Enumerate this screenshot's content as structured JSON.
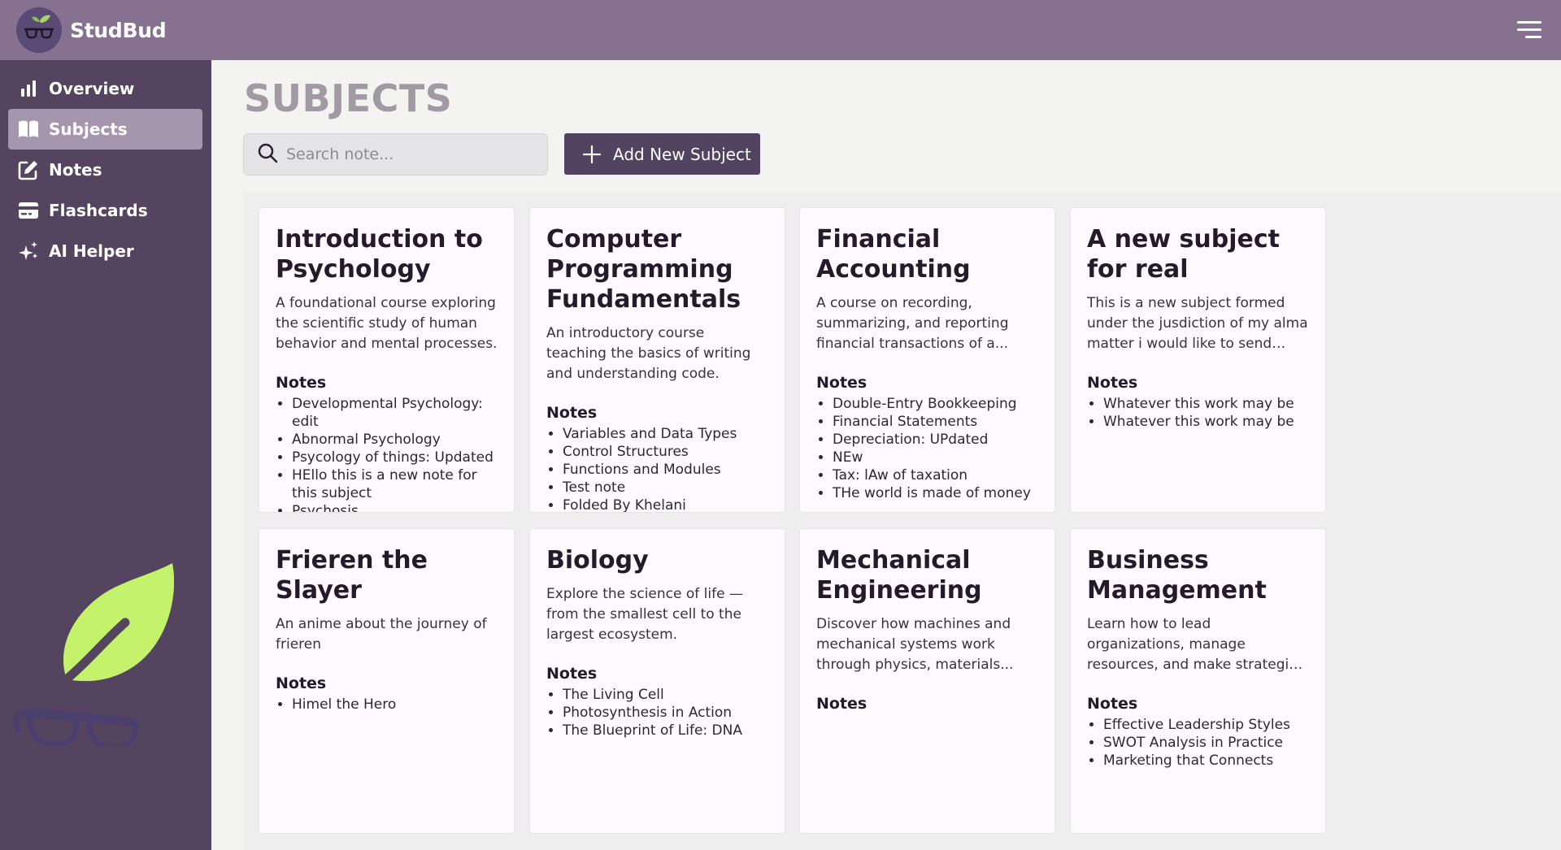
{
  "app": {
    "name": "StudBud"
  },
  "sidebar": {
    "items": [
      {
        "label": "Overview",
        "icon": "bar-chart-icon",
        "active": false
      },
      {
        "label": "Subjects",
        "icon": "book-icon",
        "active": true
      },
      {
        "label": "Notes",
        "icon": "edit-icon",
        "active": false
      },
      {
        "label": "Flashcards",
        "icon": "card-icon",
        "active": false
      },
      {
        "label": "AI Helper",
        "icon": "sparkle-icon",
        "active": false
      }
    ]
  },
  "page": {
    "title": "SUBJECTS",
    "search_placeholder": "Search note...",
    "add_button_label": "Add New Subject"
  },
  "subjects": [
    {
      "title": "Introduction to Psychology",
      "description": "A foundational course exploring the scientific study of human behavior and mental processes.",
      "notes_label": "Notes",
      "notes": [
        "Developmental Psychology: edit",
        "Abnormal Psychology",
        "Psycology of things: Updated",
        "HEllo this is a new note for this subject",
        "Psychosis"
      ]
    },
    {
      "title": "Computer Programming Fundamentals",
      "description": "An introductory course teaching the basics of writing and understanding code.",
      "notes_label": "Notes",
      "notes": [
        "Variables and Data Types",
        "Control Structures",
        "Functions and Modules",
        "Test note",
        "Folded By Khelani"
      ]
    },
    {
      "title": "Financial Accounting",
      "description": "A course on recording, summarizing, and reporting financial transactions of a...",
      "notes_label": "Notes",
      "notes": [
        "Double-Entry Bookkeeping",
        "Financial Statements",
        "Depreciation: UPdated",
        "NEw",
        "Tax: lAw of taxation",
        "THe world is made of money"
      ]
    },
    {
      "title": "A new subject for real",
      "description": "This is a new subject formed under the jusdiction of my alma matter i would like to send aout...",
      "notes_label": "Notes",
      "notes": [
        "Whatever this work may be",
        "Whatever this work may be"
      ]
    },
    {
      "title": "Frieren the Slayer",
      "description": "An anime about the journey of frieren",
      "notes_label": "Notes",
      "notes": [
        "Himel the Hero"
      ]
    },
    {
      "title": "Biology",
      "description": "Explore the science of life — from the smallest cell to the largest ecosystem.",
      "notes_label": "Notes",
      "notes": [
        "The Living Cell",
        "Photosynthesis in Action",
        "The Blueprint of Life: DNA"
      ]
    },
    {
      "title": "Mechanical Engineering",
      "description": "Discover how machines and mechanical systems work through physics, materials...",
      "notes_label": "Notes",
      "notes": []
    },
    {
      "title": "Business Management",
      "description": "Learn how to lead organizations, manage resources, and make strategic decisions.",
      "notes_label": "Notes",
      "notes": [
        "Effective Leadership Styles",
        "SWOT Analysis in Practice",
        "Marketing that Connects"
      ]
    }
  ],
  "colors": {
    "topbar": "#867290",
    "sidebar": "#54445f",
    "sidebar_active": "#a596ad",
    "button": "#524360",
    "leaf": "#c4f26a",
    "glasses": "#4b3f6e"
  }
}
